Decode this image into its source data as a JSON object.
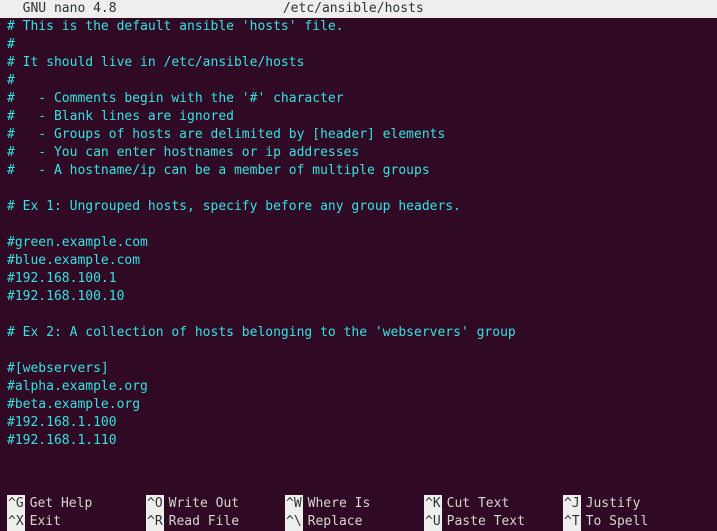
{
  "title": {
    "app": "  GNU nano 4.8",
    "file": "/etc/ansible/hosts"
  },
  "lines": [
    "# This is the default ansible 'hosts' file.",
    "#",
    "# It should live in /etc/ansible/hosts",
    "#",
    "#   - Comments begin with the '#' character",
    "#   - Blank lines are ignored",
    "#   - Groups of hosts are delimited by [header] elements",
    "#   - You can enter hostnames or ip addresses",
    "#   - A hostname/ip can be a member of multiple groups",
    "",
    "# Ex 1: Ungrouped hosts, specify before any group headers.",
    "",
    "#green.example.com",
    "#blue.example.com",
    "#192.168.100.1",
    "#192.168.100.10",
    "",
    "# Ex 2: A collection of hosts belonging to the 'webservers' group",
    "",
    "#[webservers]",
    "#alpha.example.org",
    "#beta.example.org",
    "#192.168.1.100",
    "#192.168.1.110"
  ],
  "help": {
    "row1": [
      {
        "k": "^G",
        "l": "Get Help"
      },
      {
        "k": "^O",
        "l": "Write Out"
      },
      {
        "k": "^W",
        "l": "Where Is"
      },
      {
        "k": "^K",
        "l": "Cut Text"
      },
      {
        "k": "^J",
        "l": "Justify"
      }
    ],
    "row2": [
      {
        "k": "^X",
        "l": "Exit"
      },
      {
        "k": "^R",
        "l": "Read File"
      },
      {
        "k": "^\\",
        "l": "Replace"
      },
      {
        "k": "^U",
        "l": "Paste Text"
      },
      {
        "k": "^T",
        "l": "To Spell"
      }
    ]
  }
}
